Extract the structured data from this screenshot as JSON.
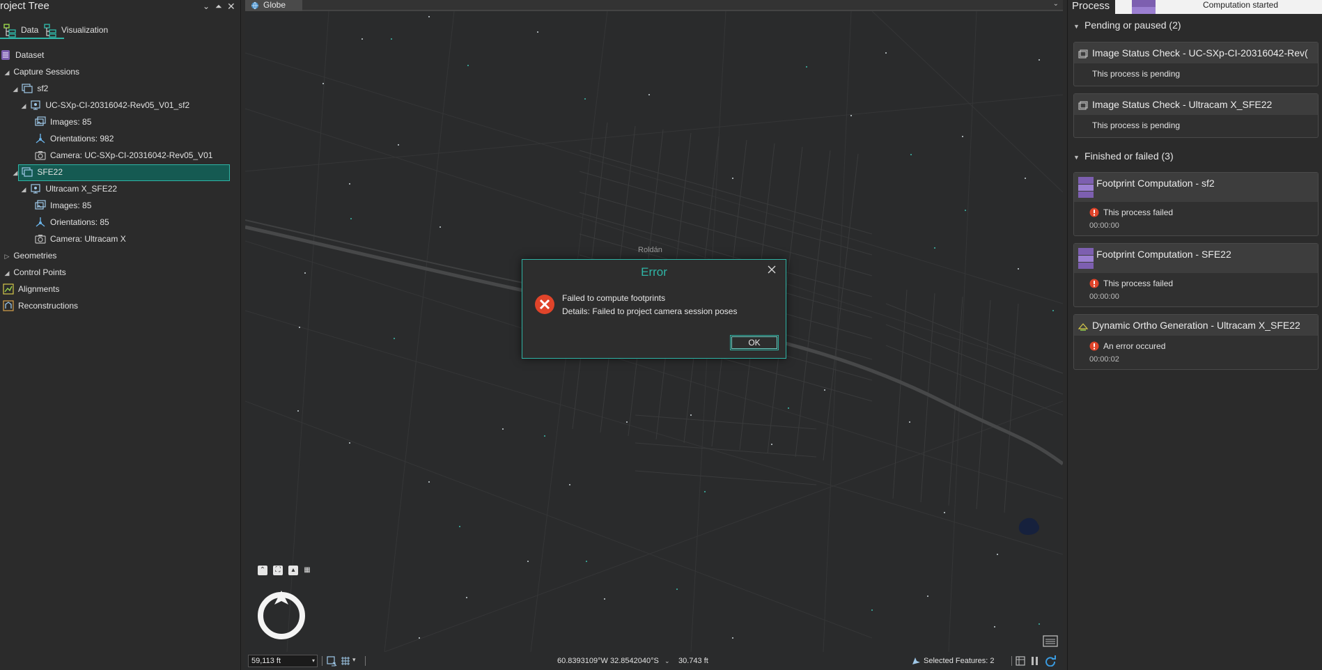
{
  "left_panel": {
    "title": "roject Tree",
    "tabs": [
      {
        "label": "Data"
      },
      {
        "label": "Visualization"
      }
    ],
    "tree": {
      "dataset": "Dataset",
      "capture_sessions": "Capture Sessions",
      "sf2": "sf2",
      "sf2_camera_session": "UC-SXp-CI-20316042-Rev05_V01_sf2",
      "sf2_images": "Images: 85",
      "sf2_orientations": "Orientations: 982",
      "sf2_camera": "Camera: UC-SXp-CI-20316042-Rev05_V01",
      "sfe22": "SFE22",
      "sfe22_camera_session": "Ultracam X_SFE22",
      "sfe22_images": "Images: 85",
      "sfe22_orientations": "Orientations: 85",
      "sfe22_camera": "Camera: Ultracam X",
      "geometries": "Geometries",
      "control_points": "Control Points",
      "alignments": "Alignments",
      "reconstructions": "Reconstructions"
    }
  },
  "map": {
    "tab_label": "Globe",
    "place_label": "Roldán",
    "statusbar": {
      "scale": "59,113 ft",
      "coordinates": "60.8393109°W 32.8542040°S",
      "elevation": "30.743 ft",
      "selected_features": "Selected Features: 2"
    }
  },
  "dialog": {
    "title": "Error",
    "message": "Failed to compute footprints",
    "details": "Details: Failed to project camera session poses",
    "ok_label": "OK"
  },
  "right_panel": {
    "title": "Process",
    "toast": "Computation started",
    "pending_section": "Pending or paused (2)",
    "finished_section": "Finished or failed (3)",
    "pending": [
      {
        "name": "Image Status Check - UC-SXp-CI-20316042-Rev(",
        "status": "This process is pending"
      },
      {
        "name": "Image Status Check - Ultracam X_SFE22",
        "status": "This process is pending"
      }
    ],
    "finished": [
      {
        "name": "Footprint Computation - sf2",
        "status": "This process failed",
        "time": "00:00:00"
      },
      {
        "name": "Footprint Computation - SFE22",
        "status": "This process failed",
        "time": "00:00:00"
      },
      {
        "name": "Dynamic Ortho Generation - Ultracam X_SFE22",
        "status": "An error occured",
        "time": "00:00:02"
      }
    ]
  },
  "colors": {
    "accent": "#2fb5a6",
    "error": "#e0442a",
    "selected_bg": "#155a52",
    "footprint_icon": "#7d5fb0"
  }
}
